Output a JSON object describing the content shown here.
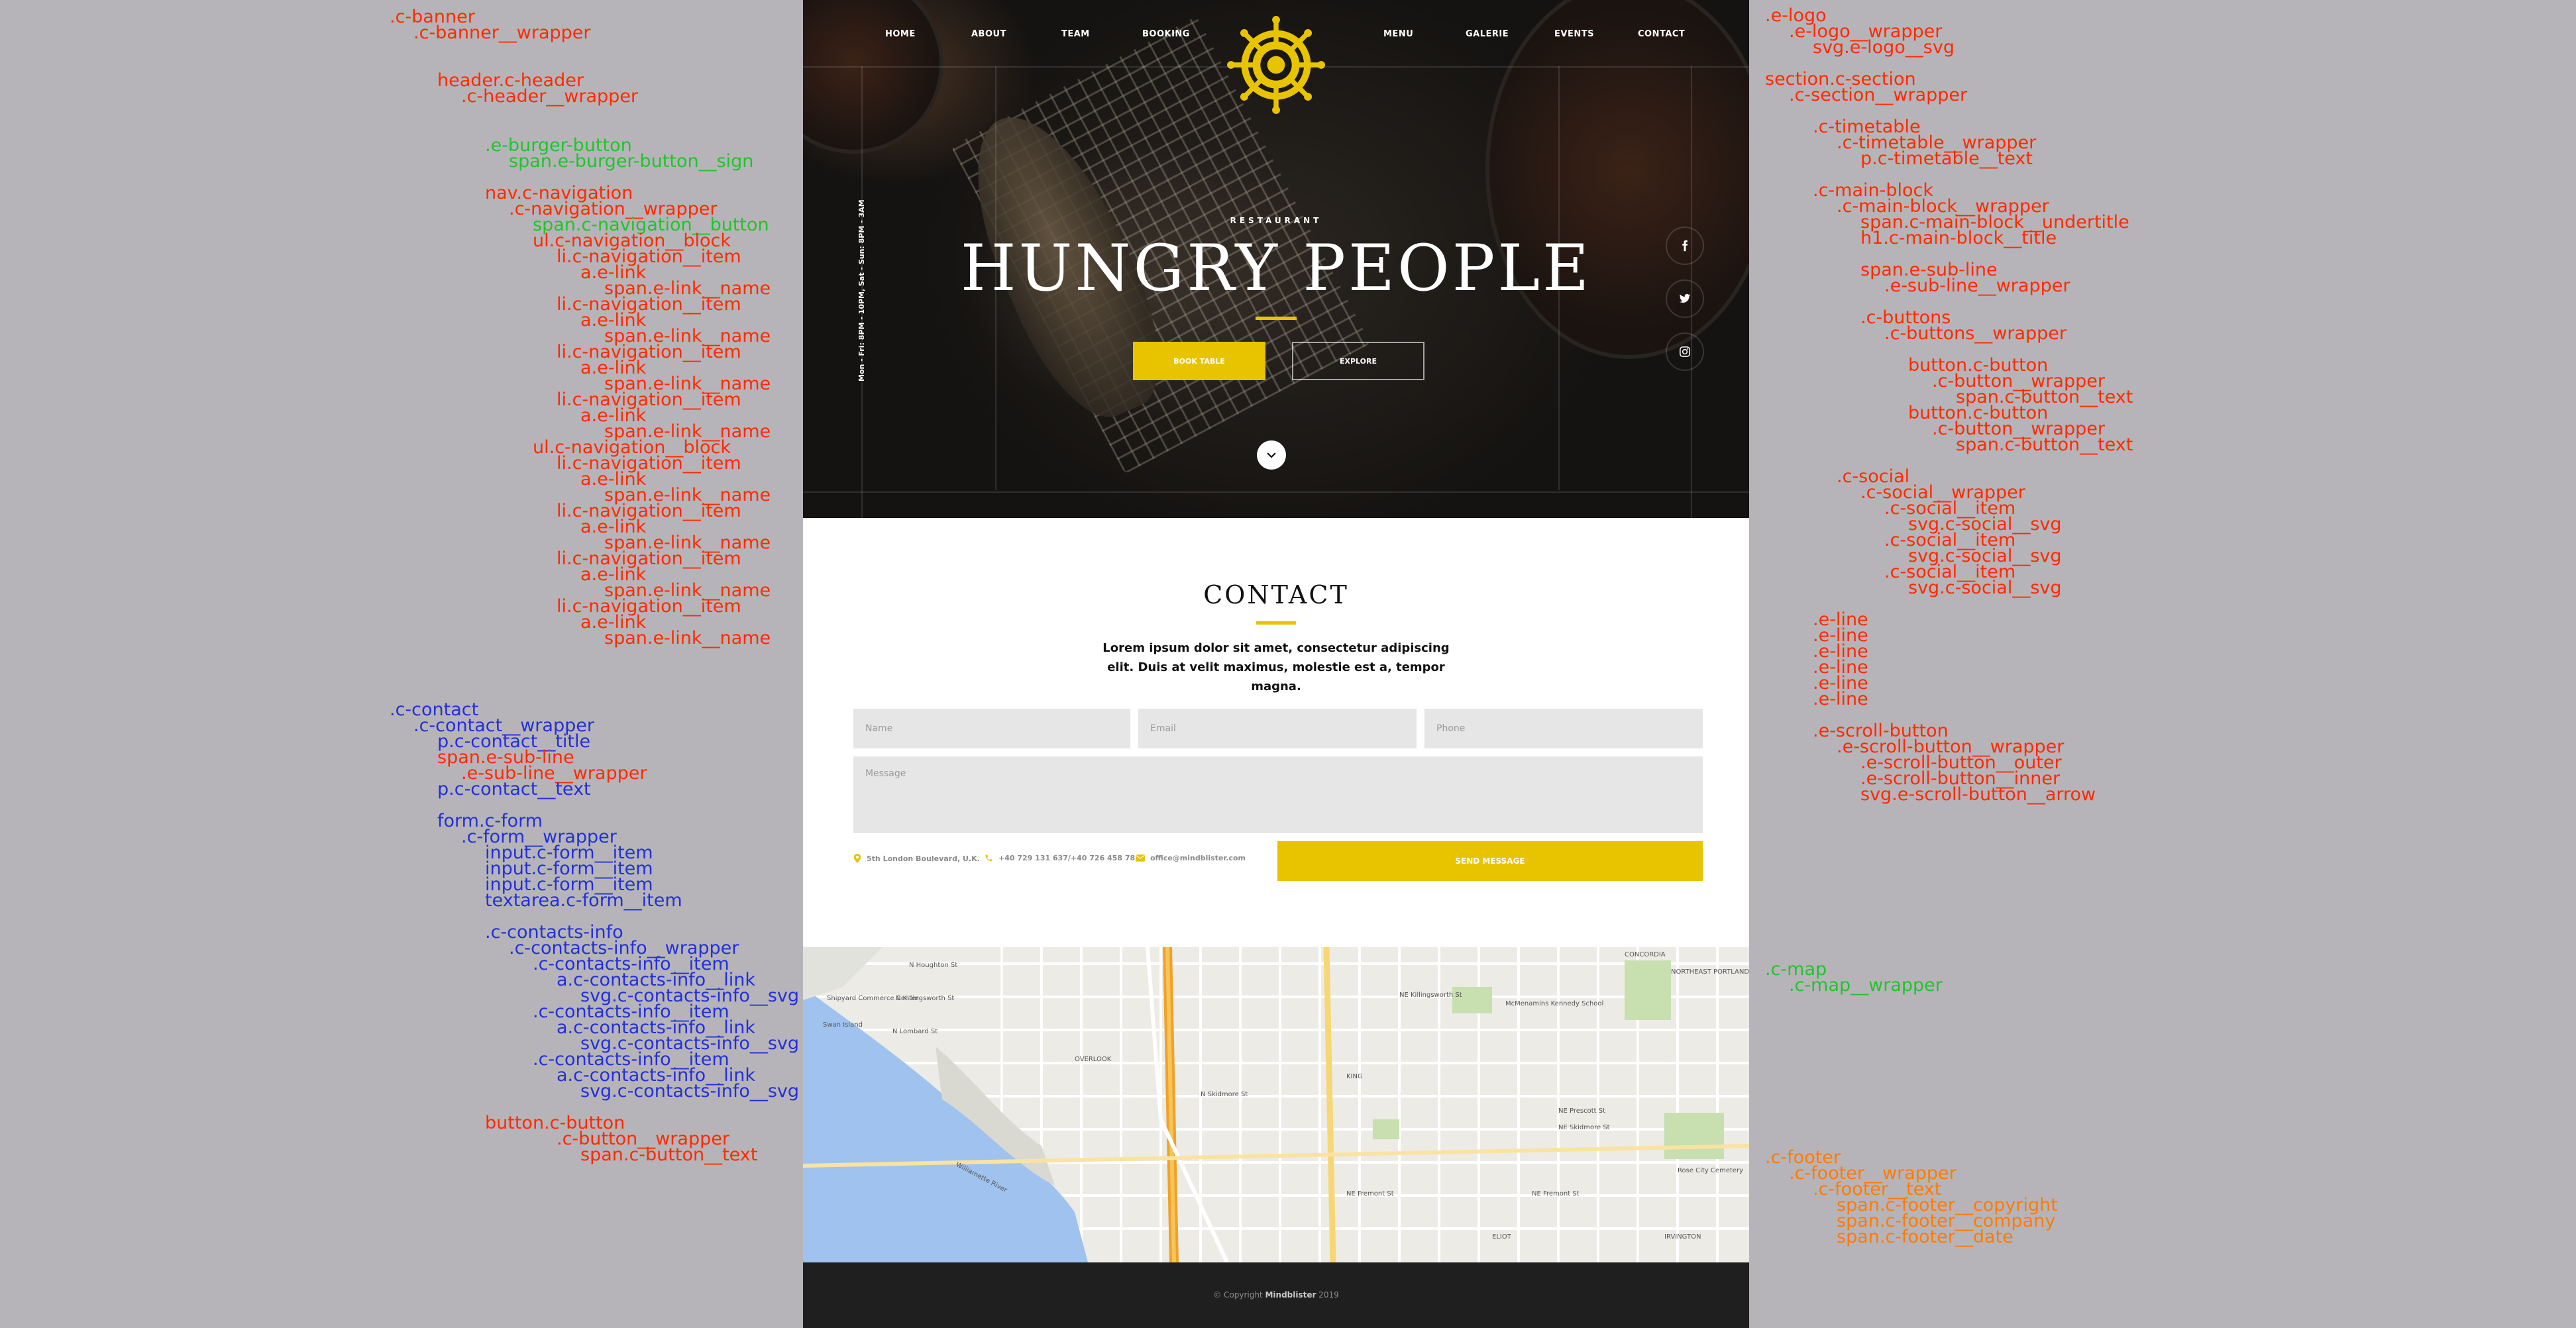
{
  "annotations": {
    "left": [
      {
        "text": ".c-banner",
        "color": "red"
      },
      {
        "text": ".c-banner__wrapper",
        "color": "red"
      },
      {
        "text": "header.c-header",
        "color": "red"
      },
      {
        "text": ".c-header__wrapper",
        "color": "red"
      },
      {
        "text": ".e-burger-button",
        "color": "green"
      },
      {
        "text": "span.e-burger-button__sign",
        "color": "green"
      },
      {
        "text": "nav.c-navigation",
        "color": "red"
      },
      {
        "text": ".c-navigation__wrapper",
        "color": "red"
      },
      {
        "text": "span.c-navigation__button",
        "color": "green"
      },
      {
        "text": "ul.c-navigation__block",
        "color": "red"
      },
      {
        "text": "li.c-navigation__item",
        "color": "red"
      },
      {
        "text": "a.e-link",
        "color": "red"
      },
      {
        "text": "span.e-link__name",
        "color": "red"
      },
      {
        "text": "li.c-navigation__item",
        "color": "red"
      },
      {
        "text": "a.e-link",
        "color": "red"
      },
      {
        "text": "span.e-link__name",
        "color": "red"
      },
      {
        "text": "li.c-navigation__item",
        "color": "red"
      },
      {
        "text": "a.e-link",
        "color": "red"
      },
      {
        "text": "span.e-link__name",
        "color": "red"
      },
      {
        "text": "li.c-navigation__item",
        "color": "red"
      },
      {
        "text": "a.e-link",
        "color": "red"
      },
      {
        "text": "span.e-link__name",
        "color": "red"
      },
      {
        "text": "ul.c-navigation__block",
        "color": "red"
      },
      {
        "text": "li.c-navigation__item",
        "color": "red"
      },
      {
        "text": "a.e-link",
        "color": "red"
      },
      {
        "text": "span.e-link__name",
        "color": "red"
      },
      {
        "text": "li.c-navigation__item",
        "color": "red"
      },
      {
        "text": "a.e-link",
        "color": "red"
      },
      {
        "text": "span.e-link__name",
        "color": "red"
      },
      {
        "text": "li.c-navigation__item",
        "color": "red"
      },
      {
        "text": "a.e-link",
        "color": "red"
      },
      {
        "text": "span.e-link__name",
        "color": "red"
      },
      {
        "text": "li.c-navigation__item",
        "color": "red"
      },
      {
        "text": "a.e-link",
        "color": "red"
      },
      {
        "text": "span.e-link__name",
        "color": "red"
      },
      {
        "text": ".c-contact",
        "color": "blue"
      },
      {
        "text": ".c-contact__wrapper",
        "color": "blue"
      },
      {
        "text": "p.c-contact__title",
        "color": "blue"
      },
      {
        "text": "span.e-sub-line",
        "color": "red"
      },
      {
        "text": ".e-sub-line__wrapper",
        "color": "red"
      },
      {
        "text": "p.c-contact__text",
        "color": "blue"
      },
      {
        "text": "form.c-form",
        "color": "blue"
      },
      {
        "text": ".c-form__wrapper",
        "color": "blue"
      },
      {
        "text": "input.c-form__item",
        "color": "blue"
      },
      {
        "text": "input.c-form__item",
        "color": "blue"
      },
      {
        "text": "input.c-form__item",
        "color": "blue"
      },
      {
        "text": "textarea.c-form__item",
        "color": "blue"
      },
      {
        "text": ".c-contacts-info",
        "color": "blue"
      },
      {
        "text": ".c-contacts-info__wrapper",
        "color": "blue"
      },
      {
        "text": ".c-contacts-info__item",
        "color": "blue"
      },
      {
        "text": "a.c-contacts-info__link",
        "color": "blue"
      },
      {
        "text": "svg.c-contacts-info__svg",
        "color": "blue"
      },
      {
        "text": ".c-contacts-info__item",
        "color": "blue"
      },
      {
        "text": "a.c-contacts-info__link",
        "color": "blue"
      },
      {
        "text": "svg.c-contacts-info__svg",
        "color": "blue"
      },
      {
        "text": ".c-contacts-info__item",
        "color": "blue"
      },
      {
        "text": "a.c-contacts-info__link",
        "color": "blue"
      },
      {
        "text": "svg.c-contacts-info__svg",
        "color": "blue"
      },
      {
        "text": "button.c-button",
        "color": "red"
      },
      {
        "text": ".c-button__wrapper",
        "color": "red"
      },
      {
        "text": "span.c-button__text",
        "color": "red"
      }
    ],
    "right": [
      {
        "text": ".e-logo",
        "color": "red"
      },
      {
        "text": ".e-logo__wrapper",
        "color": "red"
      },
      {
        "text": "svg.e-logo__svg",
        "color": "red"
      },
      {
        "text": "section.c-section",
        "color": "red"
      },
      {
        "text": ".c-section__wrapper",
        "color": "red"
      },
      {
        "text": ".c-timetable",
        "color": "red"
      },
      {
        "text": ".c-timetable__wrapper",
        "color": "red"
      },
      {
        "text": "p.c-timetable__text",
        "color": "red"
      },
      {
        "text": ".c-main-block",
        "color": "red"
      },
      {
        "text": ".c-main-block__wrapper",
        "color": "red"
      },
      {
        "text": "span.c-main-block__undertitle",
        "color": "red"
      },
      {
        "text": "h1.c-main-block__title",
        "color": "red"
      },
      {
        "text": "span.e-sub-line",
        "color": "red"
      },
      {
        "text": ".e-sub-line__wrapper",
        "color": "red"
      },
      {
        "text": ".c-buttons",
        "color": "red"
      },
      {
        "text": ".c-buttons__wrapper",
        "color": "red"
      },
      {
        "text": "button.c-button",
        "color": "red"
      },
      {
        "text": ".c-button__wrapper",
        "color": "red"
      },
      {
        "text": "span.c-button__text",
        "color": "red"
      },
      {
        "text": "button.c-button",
        "color": "red"
      },
      {
        "text": ".c-button__wrapper",
        "color": "red"
      },
      {
        "text": "span.c-button__text",
        "color": "red"
      },
      {
        "text": ".c-social",
        "color": "red"
      },
      {
        "text": ".c-social__wrapper",
        "color": "red"
      },
      {
        "text": ".c-social__item",
        "color": "red"
      },
      {
        "text": "svg.c-social__svg",
        "color": "red"
      },
      {
        "text": ".c-social__item",
        "color": "red"
      },
      {
        "text": "svg.c-social__svg",
        "color": "red"
      },
      {
        "text": ".c-social__item",
        "color": "red"
      },
      {
        "text": "svg.c-social__svg",
        "color": "red"
      },
      {
        "text": ".e-line",
        "color": "red"
      },
      {
        "text": ".e-line",
        "color": "red"
      },
      {
        "text": ".e-line",
        "color": "red"
      },
      {
        "text": ".e-line",
        "color": "red"
      },
      {
        "text": ".e-line",
        "color": "red"
      },
      {
        "text": ".e-line",
        "color": "red"
      },
      {
        "text": ".e-scroll-button",
        "color": "red"
      },
      {
        "text": ".e-scroll-button__wrapper",
        "color": "red"
      },
      {
        "text": ".e-scroll-button__outer",
        "color": "red"
      },
      {
        "text": ".e-scroll-button__inner",
        "color": "red"
      },
      {
        "text": "svg.e-scroll-button__arrow",
        "color": "red"
      },
      {
        "text": ".c-map",
        "color": "green"
      },
      {
        "text": ".c-map__wrapper",
        "color": "green"
      },
      {
        "text": ".c-footer",
        "color": "orange"
      },
      {
        "text": ".c-footer__wrapper",
        "color": "orange"
      },
      {
        "text": ".c-footer__text",
        "color": "orange"
      },
      {
        "text": "span.c-footer__copyright",
        "color": "orange"
      },
      {
        "text": "span.c-footer__company",
        "color": "orange"
      },
      {
        "text": "span.c-footer__date",
        "color": "orange"
      }
    ]
  },
  "colors": {
    "accent": "#e8c400",
    "hero_background": "#1a1714",
    "footer_background": "#1f1f1f",
    "annotation_red": "#ff2a00",
    "annotation_green": "#1ec52a",
    "annotation_blue": "#2230d8",
    "annotation_orange": "#ff7b00"
  },
  "nav": {
    "left": [
      "HOME",
      "ABOUT",
      "TEAM",
      "BOOKING"
    ],
    "right": [
      "MENU",
      "GALERIE",
      "EVENTS",
      "CONTACT"
    ]
  },
  "hero": {
    "timetable": "Mon - Fri: 8PM - 10PM, Sat - Sun: 8PM - 3AM",
    "undertitle": "RESTAURANT",
    "title": "HUNGRY PEOPLE",
    "book_button": "BOOK TABLE",
    "explore_button": "EXPLORE",
    "social_icons": [
      "facebook-icon",
      "twitter-icon",
      "instagram-icon"
    ],
    "logo_icon": "ship-wheel-logo"
  },
  "contact": {
    "title": "CONTACT",
    "text": "Lorem ipsum dolor sit amet, consectetur adipiscing elit. Duis at velit maximus, molestie est a, tempor magna.",
    "placeholders": {
      "name": "Name",
      "email": "Email",
      "phone": "Phone",
      "message": "Message"
    },
    "info": {
      "address": "5th London Boulevard, U.K.",
      "phone": "+40 729 131 637/+40 726 458 782",
      "email": "office@mindblister.com"
    },
    "send_button": "SEND MESSAGE"
  },
  "map": {
    "labels": [
      "N Houghton St",
      "N Lombard St",
      "OVERLOOK",
      "KING",
      "ELIOT",
      "IRVINGTON",
      "CONCORDIA",
      "Williamette River",
      "N Killingsworth St",
      "NE Killingsworth St",
      "NE Prescott St",
      "NE Skidmore St",
      "N Skidmore St",
      "NE Fremont St",
      "NE Fremont St",
      "Swan Island",
      "McMenamins Kennedy School",
      "Rose City Cemetery",
      "NORTHEAST PORTLAND",
      "Shipyard Commerce Center"
    ]
  },
  "footer": {
    "copyright": "© Copyright",
    "company": "Mindblister",
    "date": "2019"
  }
}
